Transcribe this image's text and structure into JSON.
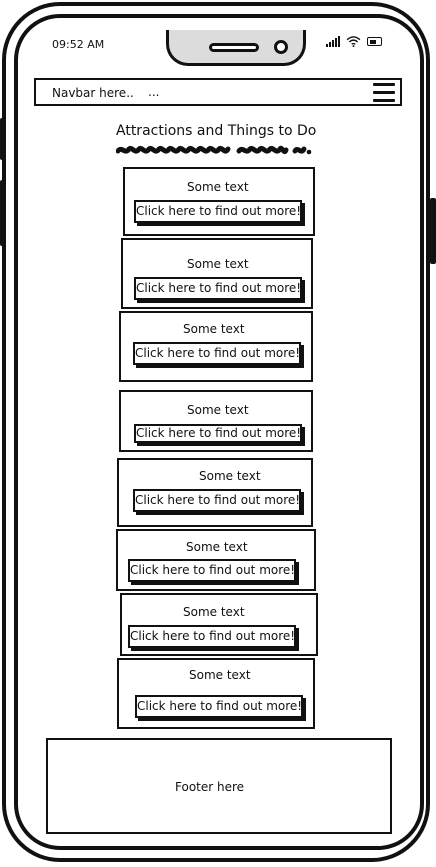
{
  "status_bar": {
    "time": "09:52 AM"
  },
  "navbar": {
    "label": "Navbar here..",
    "dots": "..."
  },
  "page": {
    "title": "Attractions and Things to Do"
  },
  "cards": [
    {
      "text": "Some text",
      "button": "Click here to find out more!"
    },
    {
      "text": "Some text",
      "button": "Click here to find out more!"
    },
    {
      "text": "Some text",
      "button": "Click here to find out more!"
    },
    {
      "text": "Some text",
      "button": "Click here to find out more!"
    },
    {
      "text": "Some text",
      "button": "Click here to find out more!"
    },
    {
      "text": "Some text",
      "button": "Click here to find out more!"
    },
    {
      "text": "Some text",
      "button": "Click here to find out more!"
    },
    {
      "text": "Some text",
      "button": "Click here to find out more!"
    }
  ],
  "footer": {
    "text": "Footer here"
  }
}
